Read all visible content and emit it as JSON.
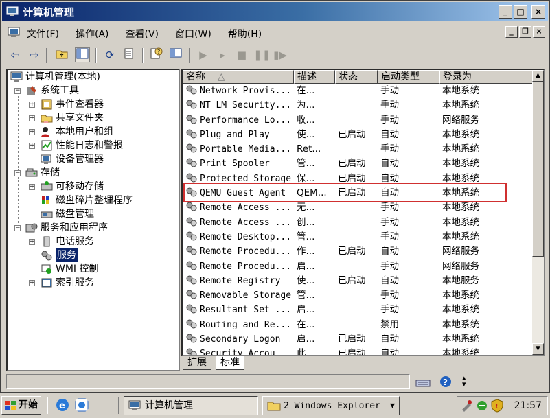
{
  "window": {
    "title": "计算机管理"
  },
  "menu": {
    "items": [
      "文件(F)",
      "操作(A)",
      "查看(V)",
      "窗口(W)",
      "帮助(H)"
    ]
  },
  "tree": {
    "root": "计算机管理(本地)",
    "system_tools": "系统工具",
    "event_viewer": "事件查看器",
    "shared_folders": "共享文件夹",
    "local_users": "本地用户和组",
    "perf_logs": "性能日志和警报",
    "device_manager": "设备管理器",
    "storage": "存储",
    "removable_storage": "可移动存储",
    "defrag": "磁盘碎片整理程序",
    "disk_mgmt": "磁盘管理",
    "services_apps": "服务和应用程序",
    "telephony": "电话服务",
    "services": "服务",
    "wmi": "WMI 控制",
    "indexing": "索引服务"
  },
  "list": {
    "columns": [
      "名称",
      "描述",
      "状态",
      "启动类型",
      "登录为"
    ],
    "sort_indicator": "△",
    "rows": [
      {
        "name": "Network Provis...",
        "desc": "在...",
        "status": "",
        "startup": "手动",
        "logon": "本地系统"
      },
      {
        "name": "NT LM Security...",
        "desc": "为...",
        "status": "",
        "startup": "手动",
        "logon": "本地系统"
      },
      {
        "name": "Performance Lo...",
        "desc": "收...",
        "status": "",
        "startup": "手动",
        "logon": "网络服务"
      },
      {
        "name": "Plug and Play",
        "desc": "使...",
        "status": "已启动",
        "startup": "自动",
        "logon": "本地系统"
      },
      {
        "name": "Portable Media...",
        "desc": "Ret...",
        "status": "",
        "startup": "手动",
        "logon": "本地系统"
      },
      {
        "name": "Print Spooler",
        "desc": "管...",
        "status": "已启动",
        "startup": "自动",
        "logon": "本地系统"
      },
      {
        "name": "Protected Storage",
        "desc": "保...",
        "status": "已启动",
        "startup": "自动",
        "logon": "本地系统"
      },
      {
        "name": "QEMU Guest Agent",
        "desc": "QEM...",
        "status": "已启动",
        "startup": "自动",
        "logon": "本地系统"
      },
      {
        "name": "Remote Access ...",
        "desc": "无...",
        "status": "",
        "startup": "手动",
        "logon": "本地系统"
      },
      {
        "name": "Remote Access ...",
        "desc": "创...",
        "status": "",
        "startup": "手动",
        "logon": "本地系统"
      },
      {
        "name": "Remote Desktop...",
        "desc": "管...",
        "status": "",
        "startup": "手动",
        "logon": "本地系统"
      },
      {
        "name": "Remote Procedu...",
        "desc": "作...",
        "status": "已启动",
        "startup": "自动",
        "logon": "网络服务"
      },
      {
        "name": "Remote Procedu...",
        "desc": "启...",
        "status": "",
        "startup": "手动",
        "logon": "网络服务"
      },
      {
        "name": "Remote Registry",
        "desc": "使...",
        "status": "已启动",
        "startup": "自动",
        "logon": "本地服务"
      },
      {
        "name": "Removable Storage",
        "desc": "管...",
        "status": "",
        "startup": "手动",
        "logon": "本地系统"
      },
      {
        "name": "Resultant Set ...",
        "desc": "启...",
        "status": "",
        "startup": "手动",
        "logon": "本地系统"
      },
      {
        "name": "Routing and Re...",
        "desc": "在...",
        "status": "",
        "startup": "禁用",
        "logon": "本地系统"
      },
      {
        "name": "Secondary Logon",
        "desc": "启...",
        "status": "已启动",
        "startup": "自动",
        "logon": "本地系统"
      },
      {
        "name": "Security Accou...",
        "desc": "此...",
        "status": "已启动",
        "startup": "自动",
        "logon": "本地系统"
      }
    ]
  },
  "tabs": {
    "extended": "扩展",
    "standard": "标准"
  },
  "taskbar": {
    "start": "开始",
    "task1": "计算机管理",
    "task2": "2 Windows Explorer",
    "task2_arrow": "▾",
    "clock": "21:57"
  },
  "colors": {
    "title_start": "#0a246a",
    "title_end": "#a6caf0",
    "highlight_border": "#d03030",
    "selection": "#0a246a"
  }
}
